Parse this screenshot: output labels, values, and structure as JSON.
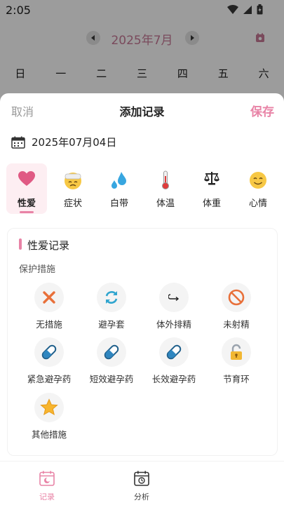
{
  "status_bar": {
    "time": "2:05"
  },
  "calendar": {
    "month_title": "2025年7月",
    "weekdays": [
      "日",
      "一",
      "二",
      "三",
      "四",
      "五",
      "六"
    ]
  },
  "sheet": {
    "cancel_label": "取消",
    "title": "添加记录",
    "save_label": "保存",
    "date": "2025年07月04日"
  },
  "categories": [
    {
      "label": "性爱",
      "icon": "heart-icon",
      "active": true
    },
    {
      "label": "症状",
      "icon": "sick-face-icon",
      "active": false
    },
    {
      "label": "白带",
      "icon": "droplets-icon",
      "active": false
    },
    {
      "label": "体温",
      "icon": "thermometer-icon",
      "active": false
    },
    {
      "label": "体重",
      "icon": "scale-icon",
      "active": false
    },
    {
      "label": "心情",
      "icon": "smile-face-icon",
      "active": false
    }
  ],
  "record_card": {
    "title": "性爱记录",
    "section_label": "保护措施",
    "options": [
      {
        "label": "无措施",
        "icon": "cross-icon"
      },
      {
        "label": "避孕套",
        "icon": "refresh-icon"
      },
      {
        "label": "体外排精",
        "icon": "hook-arrow-icon"
      },
      {
        "label": "未射精",
        "icon": "prohibited-icon"
      },
      {
        "label": "紧急避孕药",
        "icon": "pill-icon"
      },
      {
        "label": "短效避孕药",
        "icon": "pill-icon"
      },
      {
        "label": "长效避孕药",
        "icon": "pill-icon"
      },
      {
        "label": "节育环",
        "icon": "lock-icon"
      },
      {
        "label": "其他措施",
        "icon": "star-icon"
      }
    ]
  },
  "tabbar": {
    "record_label": "记录",
    "analysis_label": "分析"
  },
  "colors": {
    "accent": "#e883a6",
    "active_bg": "#fdeef2",
    "option_bg": "#f4f4f4"
  }
}
